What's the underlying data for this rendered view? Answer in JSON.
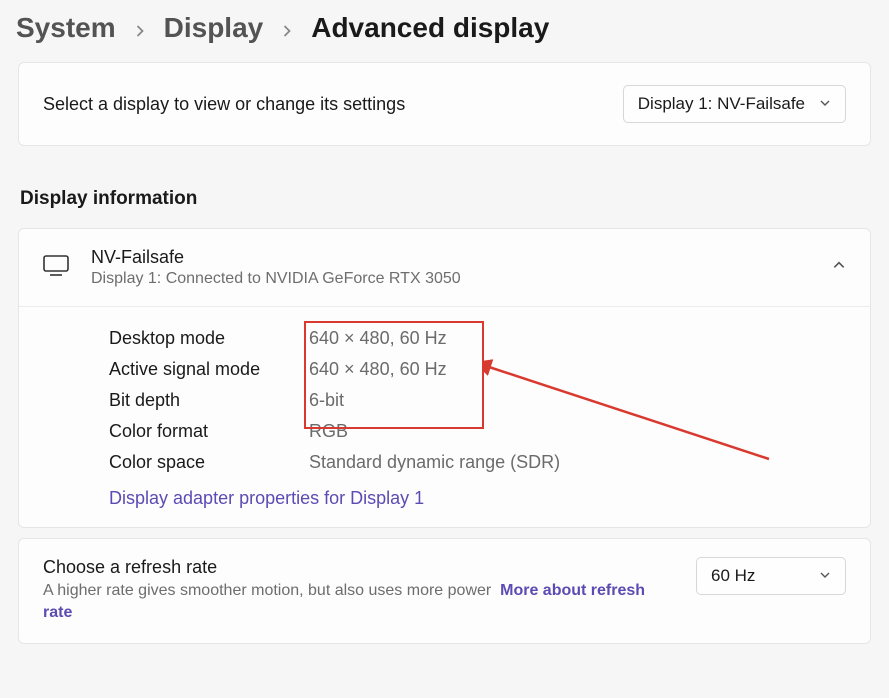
{
  "breadcrumb": {
    "items": [
      {
        "label": "System"
      },
      {
        "label": "Display"
      },
      {
        "label": "Advanced display"
      }
    ]
  },
  "select_display": {
    "label": "Select a display to view or change its settings",
    "selected": "Display 1: NV-Failsafe"
  },
  "display_info": {
    "section_title": "Display information",
    "name": "NV-Failsafe",
    "subtitle": "Display 1: Connected to NVIDIA GeForce RTX 3050",
    "rows": [
      {
        "key": "Desktop mode",
        "value": "640 × 480, 60 Hz"
      },
      {
        "key": "Active signal mode",
        "value": "640 × 480, 60 Hz"
      },
      {
        "key": "Bit depth",
        "value": "6-bit"
      },
      {
        "key": "Color format",
        "value": "RGB"
      },
      {
        "key": "Color space",
        "value": "Standard dynamic range (SDR)"
      }
    ],
    "adapter_link": "Display adapter properties for Display 1"
  },
  "refresh": {
    "title": "Choose a refresh rate",
    "desc": "A higher rate gives smoother motion, but also uses more power",
    "more_link": "More about refresh rate",
    "selected": "60 Hz"
  },
  "annotation": {
    "color": "#d93a2f"
  }
}
